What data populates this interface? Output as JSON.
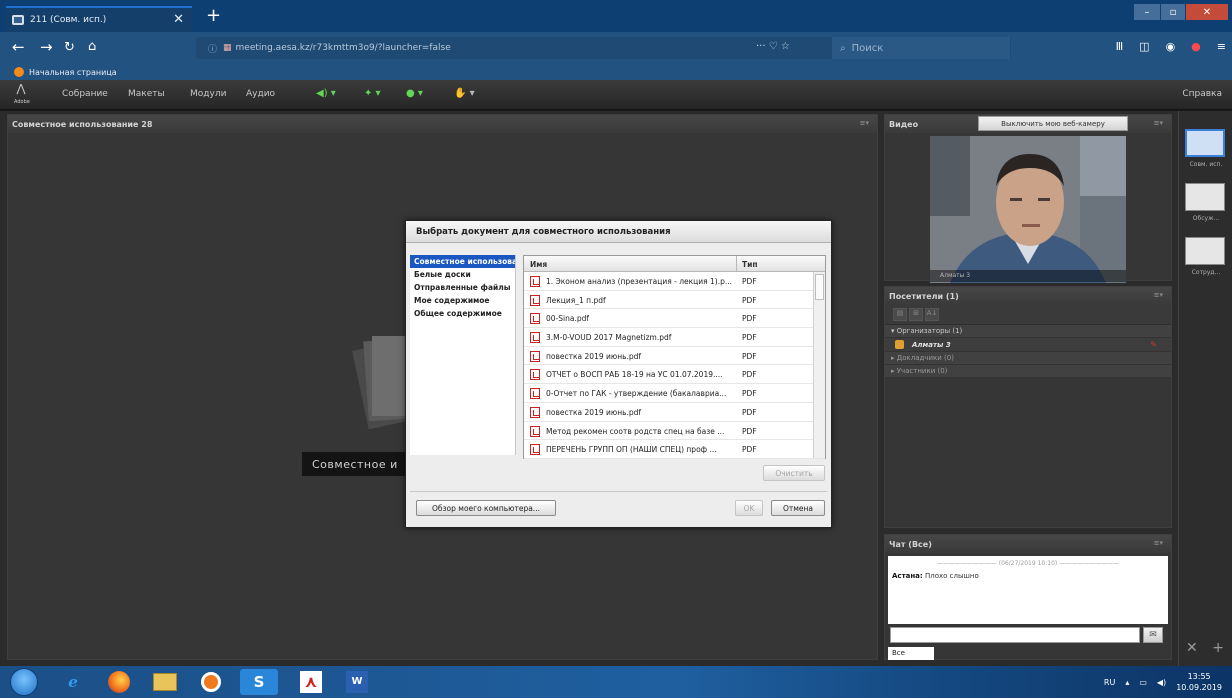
{
  "browser": {
    "tab_title": "211 (Совм. исп.)",
    "tab_close": "✕",
    "new_tab": "+",
    "url": "meeting.aesa.kz/r73kmttm3o9/?launcher=false",
    "url_actions": "··· ♡ ☆",
    "search_placeholder": "Поиск",
    "bookmark": "Начальная страница"
  },
  "menubar": {
    "logo": "Adobe",
    "items": [
      "Собрание",
      "Макеты",
      "Модули",
      "Аудио"
    ],
    "help": "Справка"
  },
  "share_pod": {
    "title": "Совместное использование 28",
    "bg_label": "Совместное и"
  },
  "video_pod": {
    "title": "Видео",
    "webcam_button": "Выключить мою веб-камеру",
    "name": "Алматы 3"
  },
  "attendees_pod": {
    "title": "Посетители (1)",
    "groups": [
      {
        "label": "▾ Организаторы (1)",
        "open": true
      },
      {
        "label": "▸ Докладчики (0)",
        "open": false
      },
      {
        "label": "▸ Участники (0)",
        "open": false
      }
    ],
    "host_name": "Алматы 3"
  },
  "chat_pod": {
    "title": "Чат (Все)",
    "date_line": "(06/27/2019 10:10)",
    "message_author": "Астана:",
    "message_text": "Плохо слышно",
    "target": "Все"
  },
  "layouts": [
    {
      "label": "Совм. исп.",
      "selected": true
    },
    {
      "label": "Обсуж...",
      "selected": false
    },
    {
      "label": "Сотруд...",
      "selected": false
    }
  ],
  "dialog": {
    "title": "Выбрать документ для совместного использования",
    "categories": [
      {
        "label": "Совместное использование",
        "selected": true
      },
      {
        "label": "Белые доски",
        "selected": false
      },
      {
        "label": "Отправленные файлы",
        "selected": false
      },
      {
        "label": "Мое содержимое",
        "selected": false
      },
      {
        "label": "Общее содержимое",
        "selected": false
      }
    ],
    "col_name": "Имя",
    "col_type": "Тип",
    "files": [
      {
        "name": "1. Эконом анализ (презентация - лекция 1).p...",
        "type": "PDF"
      },
      {
        "name": "Лекция_1 п.pdf",
        "type": "PDF"
      },
      {
        "name": "00-Sina.pdf",
        "type": "PDF"
      },
      {
        "name": "3.M-0-VOUD 2017 Magnetizm.pdf",
        "type": "PDF"
      },
      {
        "name": "повестка 2019 июнь.pdf",
        "type": "PDF"
      },
      {
        "name": "ОТЧЕТ о ВОСП РАБ 18-19 на УС 01.07.2019....",
        "type": "PDF"
      },
      {
        "name": "0-Отчет по ГАК - утверждение (бакалавриа...",
        "type": "PDF"
      },
      {
        "name": "повестка 2019 июнь.pdf",
        "type": "PDF"
      },
      {
        "name": "Метод рекомен соотв родств спец на базе ...",
        "type": "PDF"
      },
      {
        "name": "ПЕРЕЧЕНЬ ГРУПП ОП (НАШИ СПЕЦ) проф ...",
        "type": "PDF"
      }
    ],
    "clear_button": "Очистить",
    "browse_button": "Обзор моего компьютера...",
    "ok_button": "OK",
    "cancel_button": "Отмена"
  },
  "taskbar": {
    "lang": "RU",
    "time": "13:55",
    "date": "10.09.2019"
  }
}
